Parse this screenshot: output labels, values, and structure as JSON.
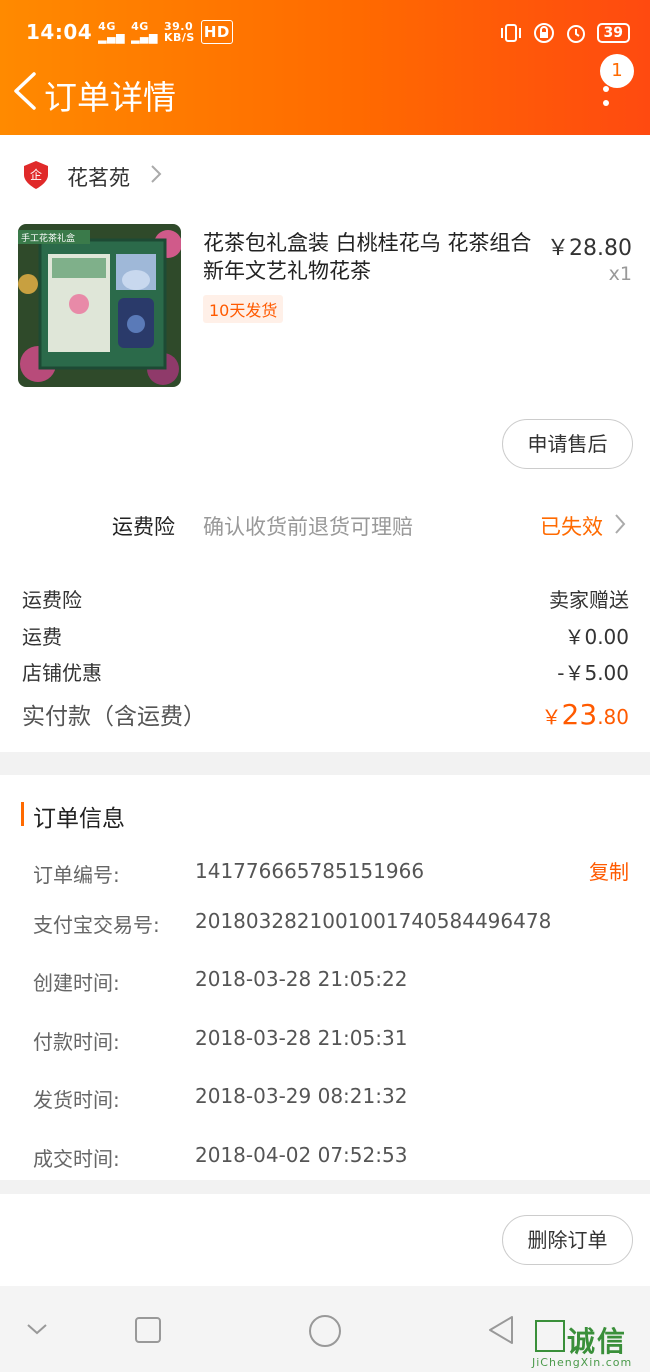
{
  "status_bar": {
    "time": "14:04",
    "net1": "4G",
    "net2": "4G",
    "speed_top": "39.0",
    "speed_bottom": "KB/S",
    "hd": "HD",
    "battery": "39"
  },
  "header": {
    "title": "订单详情",
    "badge_count": "1"
  },
  "shop": {
    "name": "花茗苑"
  },
  "product": {
    "title": "花茶包礼盒装 白桃桂花乌 花茶组合 新年文艺礼物花茶",
    "price": "￥28.80",
    "qty": "x1",
    "ship_tag": "10天发货",
    "image_caption": "手工花茶礼盒"
  },
  "actions": {
    "after_sales": "申请售后",
    "delete_order": "删除订单"
  },
  "insurance": {
    "label": "运费险",
    "desc": "确认收货前退货可理赔",
    "status": "已失效"
  },
  "fees": [
    {
      "label": "运费险",
      "value": "卖家赠送"
    },
    {
      "label": "运费",
      "value": "￥0.00"
    },
    {
      "label": "店铺优惠",
      "value": "-￥5.00"
    }
  ],
  "total": {
    "label": "实付款（含运费）",
    "symbol": "￥",
    "int": "23",
    "dec": ".80"
  },
  "order_info": {
    "title": "订单信息",
    "copy_label": "复制",
    "rows": [
      {
        "label": "订单编号:",
        "value": "141776665785151966"
      },
      {
        "label": "支付宝交易号:",
        "value": "2018032821001001740584496478"
      },
      {
        "label": "创建时间:",
        "value": "2018-03-28 21:05:22"
      },
      {
        "label": "付款时间:",
        "value": "2018-03-28 21:05:31"
      },
      {
        "label": "发货时间:",
        "value": "2018-03-29 08:21:32"
      },
      {
        "label": "成交时间:",
        "value": "2018-04-02 07:52:53"
      }
    ]
  },
  "watermark": {
    "text": "诚信",
    "url": "JiChengXin.com"
  },
  "colors": {
    "accent": "#ff6a00",
    "price": "#ff5a00"
  }
}
